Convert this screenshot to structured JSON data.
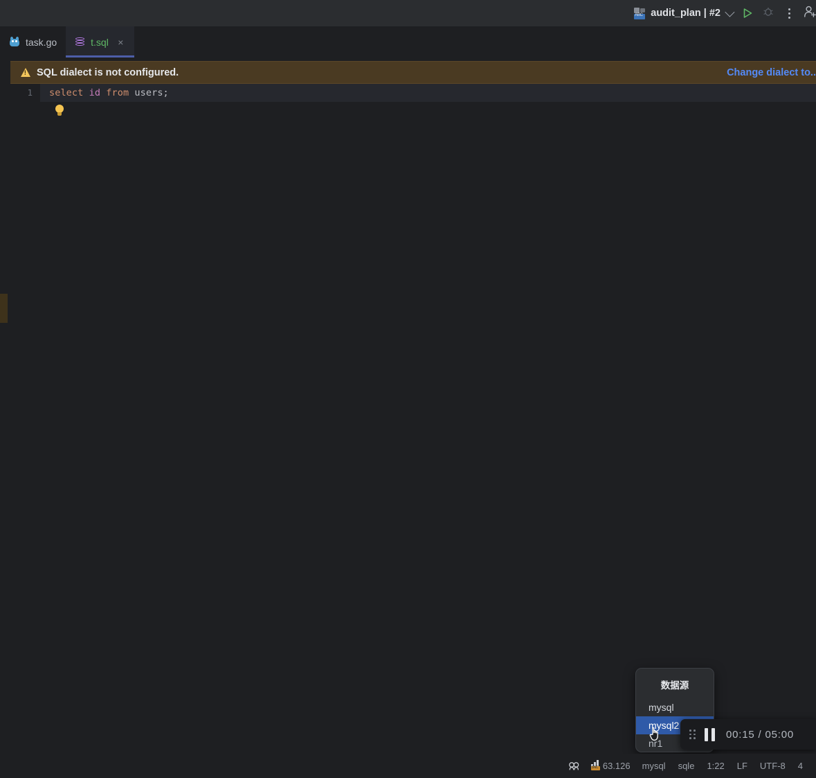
{
  "toolbar": {
    "run_config_label": "audit_plan | #2",
    "run_config_icon": "module-icon",
    "chevron_icon": "chevron-down-icon",
    "run_icon": "run-triangle-icon",
    "debug_icon": "debug-bug-icon",
    "more_icon": "more-vertical-icon",
    "account_icon": "add-user-icon",
    "accent_run_color": "#5fb865"
  },
  "tabs": [
    {
      "label": "task.go",
      "icon": "go-gopher-icon",
      "active": false,
      "closable": false
    },
    {
      "label": "t.sql",
      "icon": "database-icon",
      "active": true,
      "closable": true,
      "close_glyph": "×"
    }
  ],
  "warning": {
    "icon": "warning-triangle-icon",
    "message": "SQL dialect is not configured.",
    "action_link": "Change dialect to..",
    "background": "#4a3a22",
    "link_color": "#548af7"
  },
  "editor": {
    "line_number": "1",
    "code_tokens": [
      {
        "text": "select ",
        "type": "keyword"
      },
      {
        "text": "id ",
        "type": "column"
      },
      {
        "text": "from ",
        "type": "keyword"
      },
      {
        "text": "users;",
        "type": "plain"
      }
    ],
    "code_full": "select id from users;",
    "intention_icon": "lightbulb-icon",
    "marker_icon": "gutter-warning-marker"
  },
  "datasource_popup": {
    "title": "数据源",
    "items": [
      {
        "label": "mysql",
        "selected": false
      },
      {
        "label": "mysql2",
        "selected": true
      },
      {
        "label": "nr1",
        "selected": false
      }
    ],
    "highlight_color": "#2f5aa8"
  },
  "player": {
    "grip_icon": "drag-grip-icon",
    "pause_icon": "pause-icon",
    "current_time": "00:15",
    "separator": "/",
    "total_time": "05:00",
    "time_display": "00:15 / 05:00"
  },
  "cursor": {
    "icon": "pointing-hand-cursor"
  },
  "statusbar": {
    "branch_icon": "vcs-icon",
    "memory_icon": "memory-indicator-icon",
    "memory_value": "63.126",
    "items": [
      {
        "label": "mysql",
        "name": "datasource"
      },
      {
        "label": "sqle",
        "name": "scheme"
      },
      {
        "label": "1:22",
        "name": "caret-position"
      },
      {
        "label": "LF",
        "name": "line-separator"
      },
      {
        "label": "UTF-8",
        "name": "encoding"
      },
      {
        "label": "4",
        "name": "indent"
      }
    ]
  }
}
